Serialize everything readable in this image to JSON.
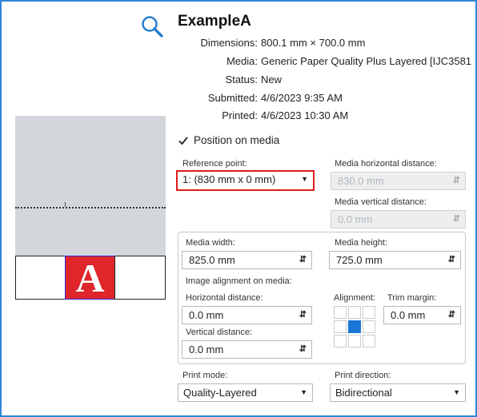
{
  "job": {
    "title": "ExampleA",
    "info": [
      {
        "label": "Dimensions:",
        "value": "800.1 mm × 700.0 mm"
      },
      {
        "label": "Media:",
        "value": "Generic Paper Quality Plus Layered [IJC3581"
      },
      {
        "label": "Status:",
        "value": "New"
      },
      {
        "label": "Submitted:",
        "value": "4/6/2023 9:35 AM"
      },
      {
        "label": "Printed:",
        "value": "4/6/2023 10:30 AM"
      }
    ]
  },
  "preview": {
    "letter": "A",
    "accent_color": "#e1262b"
  },
  "position": {
    "checkbox_label": "Position on media",
    "checked": true,
    "reference_point_label": "Reference point:",
    "reference_point_value": "1: (830 mm x 0 mm)",
    "media_horizontal_label": "Media horizontal distance:",
    "media_horizontal_value": "830.0 mm",
    "media_vertical_label": "Media vertical distance:",
    "media_vertical_value": "0.0 mm"
  },
  "media_size": {
    "width_label": "Media width:",
    "width_value": "825.0 mm",
    "height_label": "Media height:",
    "height_value": "725.0 mm"
  },
  "alignment": {
    "section_label": "Image alignment on media:",
    "horizontal_label": "Horizontal distance:",
    "horizontal_value": "0.0 mm",
    "vertical_label": "Vertical distance:",
    "vertical_value": "0.0 mm",
    "alignment_label": "Alignment:",
    "selected_cell": "middle-center",
    "trim_label": "Trim margin:",
    "trim_value": "0.0 mm"
  },
  "print": {
    "mode_label": "Print mode:",
    "mode_value": "Quality-Layered",
    "direction_label": "Print direction:",
    "direction_value": "Bidirectional"
  },
  "colors": {
    "frame_border": "#2f86d6",
    "highlight_border": "#e01b1b",
    "alignment_active": "#1877d6"
  }
}
